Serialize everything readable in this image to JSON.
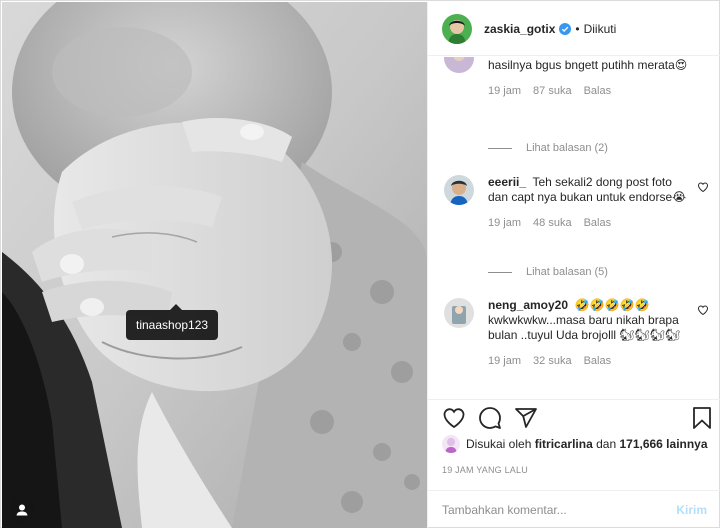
{
  "post": {
    "tag_label": "tinaashop123"
  },
  "header": {
    "username": "zaskia_gotix",
    "dot": "•",
    "follow_status": "Diikuti"
  },
  "comments": [
    {
      "text": "pemutih dr widi_naturalbeauty hasilnya bgus bngett putihh merata😍",
      "time": "19 jam",
      "likes": "87 suka",
      "reply": "Balas",
      "view_replies": "Lihat balasan (2)"
    },
    {
      "username": "eeerii_",
      "text": "Teh sekali2 dong post foto dan capt nya bukan untuk endorse😭",
      "time": "19 jam",
      "likes": "48 suka",
      "reply": "Balas",
      "view_replies": "Lihat balasan (5)"
    },
    {
      "username": "neng_amoy20",
      "text": "🤣🤣🤣🤣🤣 kwkwkwkw...masa baru nikah brapa bulan ..tuyul Uda brojolll 🐿🐿🐿🐿",
      "time": "19 jam",
      "likes": "32 suka",
      "reply": "Balas"
    }
  ],
  "likes": {
    "prefix": "Disukai oleh",
    "user": "fitricarlina",
    "mid": "dan",
    "count": "171,666 lainnya"
  },
  "timestamp": "19 JAM YANG LALU",
  "add_comment": {
    "placeholder": "Tambahkan komentar...",
    "post_label": "Kirim"
  },
  "colors": {
    "verified": "#3897f0",
    "post_disabled": "#b2dffc",
    "muted": "#8e8e8e"
  }
}
